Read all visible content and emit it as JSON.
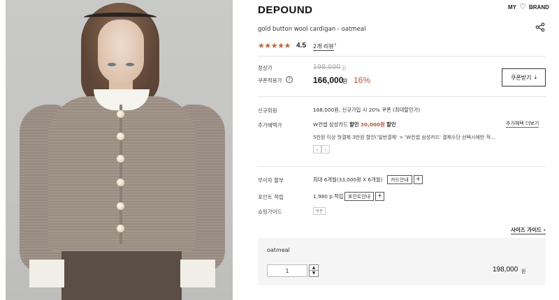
{
  "header": {
    "brand": "DEPOUND",
    "my": "MY",
    "brand_link": "BRAND",
    "product_name": "gold button wool cardigan - oatmeal"
  },
  "rating": {
    "stars_glyph": "★★★★★",
    "score": "4.5",
    "reviews_label": "2개 리뷰",
    "reviews_arrow": "›"
  },
  "price": {
    "regular_label": "정상가",
    "regular_value": "198,000",
    "regular_unit": "원",
    "coupon_label": "쿠폰적용가",
    "help_glyph": "?",
    "sale_value": "166,000",
    "sale_unit": "원",
    "discount": "16%",
    "coupon_button": "쿠폰받기",
    "download_glyph": "⤓"
  },
  "benefits": {
    "new_member_label": "신규회원",
    "new_member_value": "168,000원, 신규가입 시 20% 쿠폰 (최대할인가)",
    "extra_label": "추가혜택가",
    "extra_value_a": "W컨셉 삼성카드",
    "extra_value_b": "할인",
    "extra_value_c": "30,000원",
    "extra_value_d": "할인",
    "extra_detail": "5만원 이상 첫결제 3만원 할인('일반결제' > 'W컨셉 삼성카드' 결제수단 선택시에만 적...",
    "more_link": "추가혜택 더보기",
    "pager_prev": "‹",
    "pager_next": "›"
  },
  "payment": {
    "installment_label": "무이자 할부",
    "installment_value": "최대 6개월(33,000원 X 6개월)",
    "card_info_button": "카드안내",
    "points_label": "포인트 적립",
    "points_value": "1,980 p 적립",
    "points_info_button": "포인트안내",
    "plus": "+",
    "guide_label": "쇼핑가이드",
    "coupon_tag": "쿠폰"
  },
  "size_guide": "사이즈 가이드",
  "option": {
    "name": "oatmeal",
    "quantity": "1",
    "up": "▲",
    "down": "▼",
    "price": "198,000",
    "unit": "원"
  },
  "colors": {
    "accent": "#b35a3a",
    "star": "#c0663d",
    "option_bg": "#f5f5f5"
  },
  "icons": {
    "share": "share-icon",
    "heart": "heart-icon",
    "download": "download-icon"
  }
}
